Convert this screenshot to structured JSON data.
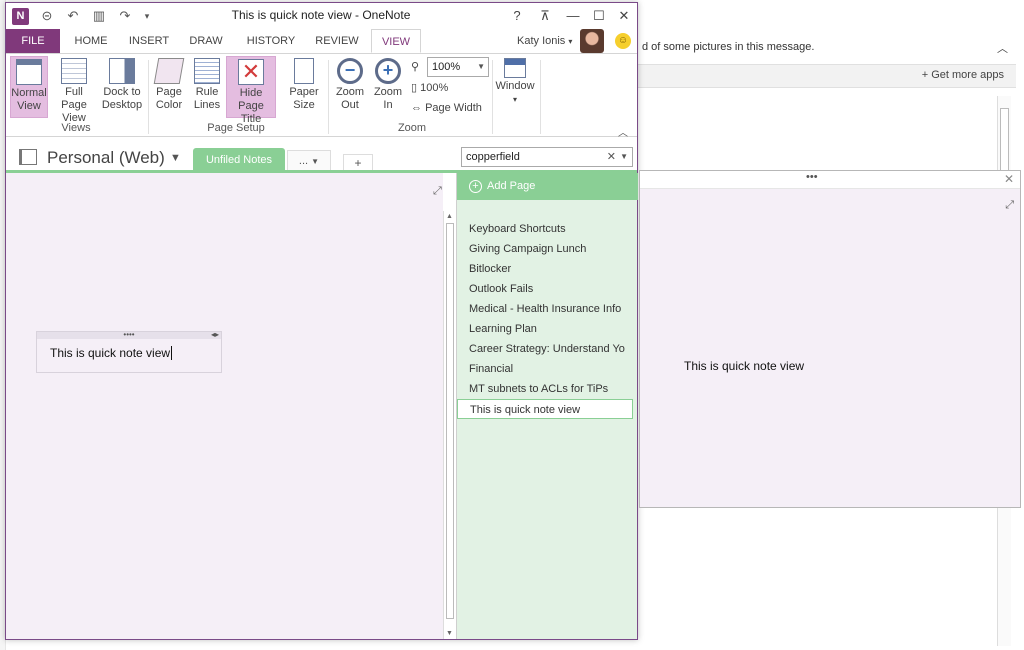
{
  "background": {
    "infobar_text": "d of some pictures in this message.",
    "get_more_apps": "+  Get more apps"
  },
  "window": {
    "title": "This is quick note view - OneNote",
    "help": "?",
    "restore_ribbon": "⊼",
    "minimize": "—",
    "maximize": "☐",
    "close": "✕"
  },
  "tabs": [
    "FILE",
    "HOME",
    "INSERT",
    "DRAW",
    "HISTORY",
    "REVIEW",
    "VIEW"
  ],
  "user": {
    "name": "Katy Ionis",
    "dropdown": "▾"
  },
  "ribbon": {
    "views": {
      "label": "Views",
      "normal": "Normal View",
      "full": "Full Page View",
      "dock": "Dock to Desktop"
    },
    "page_setup": {
      "label": "Page Setup",
      "color": "Page Color",
      "lines": "Rule Lines",
      "hide": "Hide Page Title",
      "paper": "Paper Size"
    },
    "zoom": {
      "label": "Zoom",
      "out": "Zoom Out",
      "in": "Zoom In",
      "value": "100%",
      "hundred": "100%",
      "page_width": "Page Width"
    },
    "window_label": "Window"
  },
  "notebook": {
    "name": "Personal (Web)",
    "section": "Unfiled Notes",
    "more": "...",
    "add": "+",
    "search_value": "copperfield"
  },
  "pages": {
    "add_page": "Add Page",
    "items": [
      "Keyboard Shortcuts",
      "Giving Campaign Lunch",
      "Bitlocker",
      "Outlook Fails",
      "Medical - Health Insurance Info",
      "Learning Plan",
      "Career Strategy: Understand Yo",
      "Financial",
      "MT subnets to ACLs for TiPs",
      "This is quick note view"
    ]
  },
  "note": {
    "text": "This is quick note view"
  },
  "quicknote": {
    "dots": "•••",
    "text": "This is quick note view"
  },
  "colors": {
    "accent": "#80397b",
    "section_green": "#8acf95",
    "pagelist_bg": "#e2f2e4",
    "canvas_bg": "#f5eff7"
  }
}
